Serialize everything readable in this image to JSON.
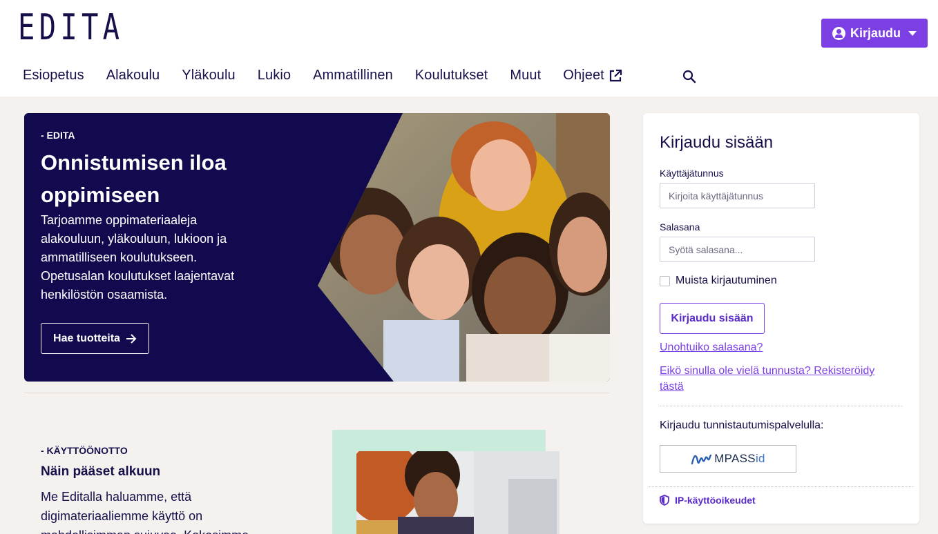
{
  "header": {
    "logo": "EDITA",
    "login_button": "Kirjaudu",
    "nav": [
      "Esiopetus",
      "Alakoulu",
      "Yläkoulu",
      "Lukio",
      "Ammatillinen",
      "Koulutukset",
      "Muut"
    ],
    "nav_external": "Ohjeet",
    "icons": {
      "user": "user-circle-icon",
      "dropdown": "caret-down-icon",
      "external": "external-link-icon",
      "search": "search-icon"
    }
  },
  "hero": {
    "kicker": "- EDITA",
    "title": "Onnistumisen iloa oppimiseen",
    "text": "Tarjoamme oppimateriaaleja alakouluun, yläkouluun, lukioon ja ammatilliseen koulutukseen. Opetusalan koulutukset laajentavat henkilöstön osaamista.",
    "button": "Hae tuotteita",
    "accent": "#110a4f"
  },
  "intro": {
    "kicker": "- KÄYTTÖÖNOTTO",
    "title": "Näin pääset alkuun",
    "text": "Me Editalla haluamme, että digimateriaaliemme käyttö on mahdollisimman sujuvaa. Kokosimme"
  },
  "login": {
    "title": "Kirjaudu sisään",
    "username_label": "Käyttäjätunnus",
    "username_placeholder": "Kirjoita käyttäjätunnus",
    "password_label": "Salasana",
    "password_placeholder": "Syötä salasana...",
    "remember": "Muista kirjautuminen",
    "submit": "Kirjaudu sisään",
    "forgot": "Unohtuiko salasana?",
    "register": "Eikö sinulla ole vielä tunnusta? Rekisteröidy tästä",
    "idp_label": "Kirjaudu tunnistautumispalvelulla:",
    "mpass_a": "MPASS",
    "mpass_b": "id",
    "ip_rights": "IP-käyttöoikeudet"
  },
  "colors": {
    "brand": "#7b3fe4",
    "navy": "#16104a",
    "mint": "#c8ebdc"
  }
}
